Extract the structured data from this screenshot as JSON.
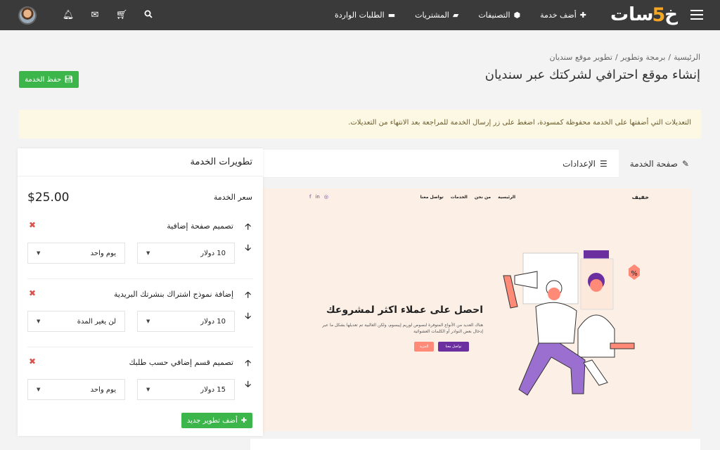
{
  "header": {
    "logo": {
      "part1": "خ",
      "five": "5",
      "part2": "سات"
    },
    "nav": [
      {
        "label": "أضف خدمة",
        "icon": "plus-icon"
      },
      {
        "label": "التصنيفات",
        "icon": "cubes-icon"
      },
      {
        "label": "المشتريات",
        "icon": "folder-open-icon"
      },
      {
        "label": "الطلبات الواردة",
        "icon": "truck-icon"
      }
    ],
    "icons": [
      "avatar",
      "bell-icon",
      "envelope-icon",
      "cart-icon",
      "search-icon"
    ]
  },
  "breadcrumb": [
    "الرئيسية",
    "/",
    "برمجة وتطوير",
    "/",
    "تطوير موقع سنديان"
  ],
  "page_title": "إنشاء موقع احترافي لشركتك عبر سنديان",
  "save_button": "حفظ الخدمة",
  "notice": "التعديلات التي أضفتها على الخدمة محفوظة كمسودة، اضغط على زر إرسال الخدمة للمراجعة بعد الانتهاء من التعديلات.",
  "tabs": [
    {
      "label": "صفحة الخدمة",
      "active": true
    },
    {
      "label": "الإعدادات",
      "active": false
    }
  ],
  "preview": {
    "brand": "خفيف",
    "menu": [
      "الرئيسية",
      "من نحن",
      "الخدمات",
      "تواصل معنا"
    ],
    "social": [
      "f",
      "in",
      "◎"
    ],
    "headline": "احصل على عملاء اكثر لمشروعك",
    "subtext": "هناك العديد من الأنواع المتوفرة لنصوص لوريم إيبسوم، ولكن الغالبية تم تعديلها بشكل ما عبر إدخال بعض النوادر أو الكلمات العشوائية",
    "btn_primary": "تواصل معنا",
    "btn_secondary": "المزيد"
  },
  "panel": {
    "title": "تطويرات الخدمة",
    "price_label": "سعر الخدمة",
    "price_value": "$25.00",
    "upgrades": [
      {
        "title": "تصميم صفحة إضافية",
        "price": "10 دولار",
        "duration": "يوم واحد"
      },
      {
        "title": "إضافة نموذج اشتراك بنشرتك البريدية",
        "price": "10 دولار",
        "duration": "لن يغير المدة"
      },
      {
        "title": "تصميم قسم إضافي حسب طلبك",
        "price": "15 دولار",
        "duration": "يوم واحد"
      }
    ],
    "add_button": "أضف تطوير جديد"
  },
  "colors": {
    "topbar": "#3a3a3a",
    "accent_green": "#3cb64a",
    "notice_bg": "#fdf8e3",
    "logo_accent": "#f5a623",
    "danger": "#d9534f",
    "preview_purple": "#6b2fa0"
  }
}
